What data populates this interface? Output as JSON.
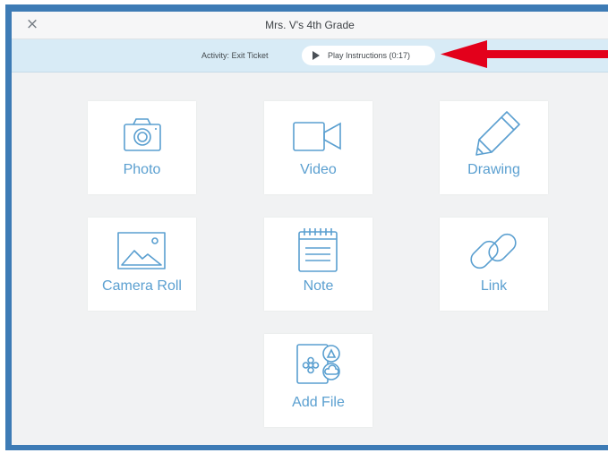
{
  "window": {
    "title": "Mrs. V's 4th Grade",
    "close_glyph": "×"
  },
  "activity": {
    "label": "Activity: Exit Ticket",
    "play_button": "Play Instructions (0:17)"
  },
  "annotation": {
    "arrow_color": "#e3001b",
    "icon": "red-arrow-pointing-left"
  },
  "accent_color": "#5a9fd0",
  "tiles": [
    {
      "label": "Photo",
      "icon": "camera-icon"
    },
    {
      "label": "Video",
      "icon": "video-camera-icon"
    },
    {
      "label": "Drawing",
      "icon": "pencil-icon"
    },
    {
      "label": "Camera Roll",
      "icon": "image-icon"
    },
    {
      "label": "Note",
      "icon": "notepad-icon"
    },
    {
      "label": "Link",
      "icon": "link-icon"
    },
    {
      "label": "Add File",
      "icon": "add-file-icon"
    }
  ]
}
